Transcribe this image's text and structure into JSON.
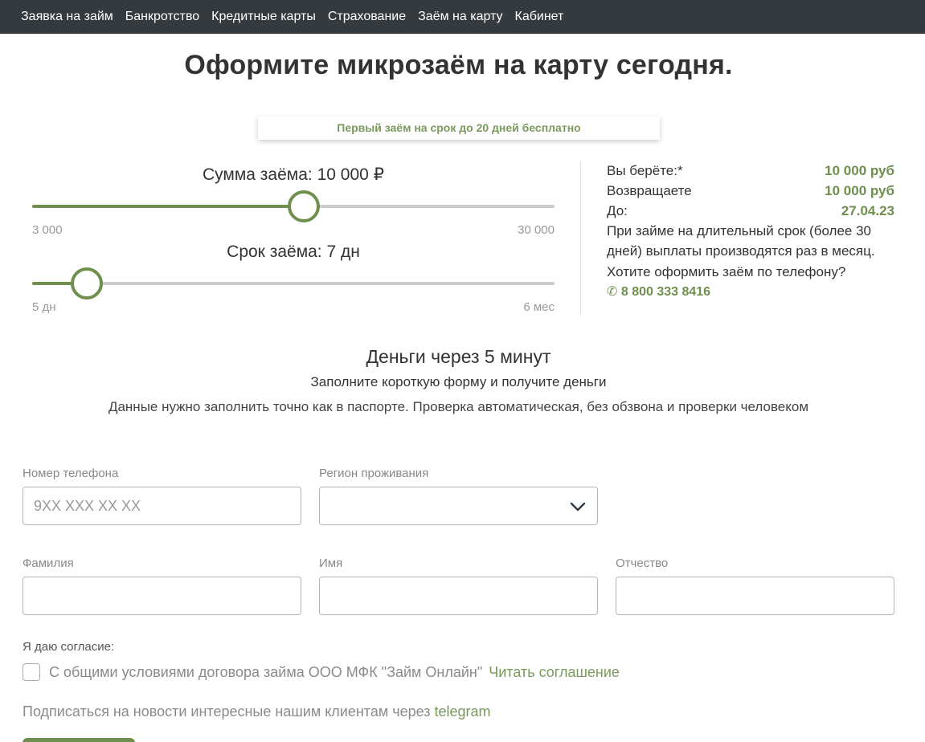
{
  "nav": {
    "items": [
      "Заявка на займ",
      "Банкротство",
      "Кредитные карты",
      "Страхование",
      "Заём на карту",
      "Кабинет"
    ]
  },
  "hero": {
    "title": "Оформите микрозаём на карту сегодня.",
    "promo": "Первый заём на срок до 20 дней бесплатно"
  },
  "amount_slider": {
    "title": "Сумма заёма: 10 000 ₽",
    "min_label": "3 000",
    "max_label": "30 000",
    "min": 3000,
    "max": 30000,
    "value": 10000
  },
  "term_slider": {
    "title": "Срок заёма: 7 дн",
    "min_label": "5 дн",
    "max_label": "6 мес",
    "position_fraction": 0.105
  },
  "summary": {
    "take_label": "Вы берёте:*",
    "take_value": "10 000 руб",
    "return_label": "Возвращаете",
    "return_value": "10 000 руб",
    "until_label": "До:",
    "until_value": "27.04.23",
    "note": "При займе на длительный срок (более 30 дней) выплаты производятся раз в месяц.",
    "phone_prompt": "Хотите оформить заём по телефону?",
    "phone_icon": "✆",
    "phone": "8 800 333 8416"
  },
  "form_intro": {
    "heading": "Деньги через 5 минут",
    "subheading": "Заполните короткую форму и получите деньги",
    "hint": "Данные нужно заполнить точно как в паспорте. Проверка автоматическая, без обзвона и проверки человеком"
  },
  "form": {
    "phone_label": "Номер телефона",
    "phone_placeholder": "9XX XXX XX XX",
    "region_label": "Регион проживания",
    "region_value": "",
    "surname_label": "Фамилия",
    "name_label": "Имя",
    "patronymic_label": "Отчество"
  },
  "consent": {
    "heading": "Я даю согласие:",
    "text": "С общими условиями договора займа ООО МФК \"Займ Онлайн\"",
    "link": "Читать соглашение",
    "checked": false
  },
  "subscribe": {
    "text": "Подписаться на новости интересные нашим клиентам через ",
    "link": "telegram"
  },
  "colors": {
    "accent": "#6f8f4e",
    "nav_bg": "#343a3e",
    "track": "#cccccc"
  }
}
